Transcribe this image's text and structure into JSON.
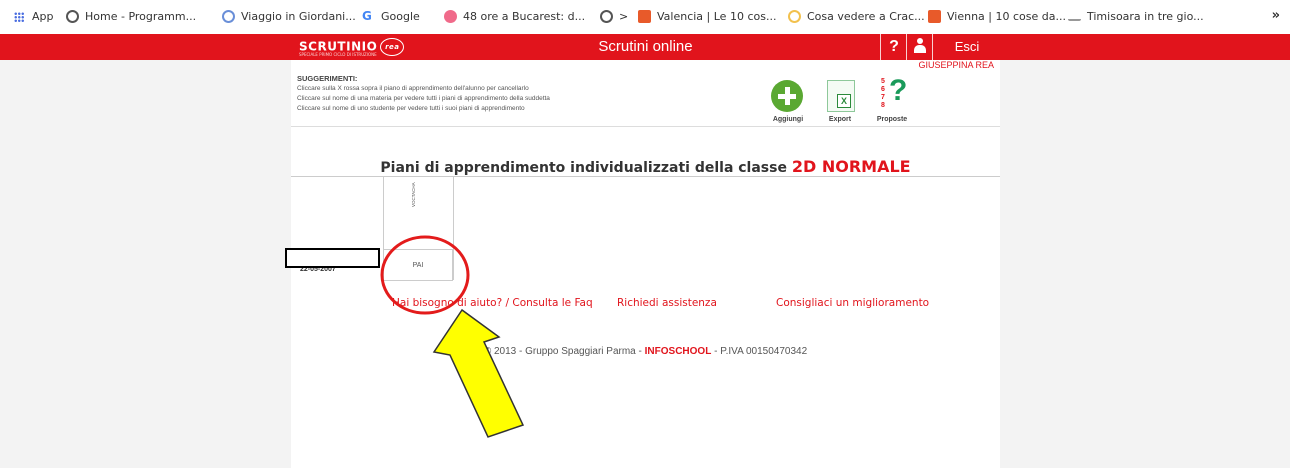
{
  "bookmarks": {
    "apps_label": "App",
    "items": [
      {
        "label": "Home - Programm..."
      },
      {
        "label": "Viaggio in Giordani..."
      },
      {
        "label": "Google"
      },
      {
        "label": "48 ore a Bucarest: d..."
      },
      {
        "label": ">"
      },
      {
        "label": "Valencia | Le 10 cos..."
      },
      {
        "label": "Cosa vedere a Crac..."
      },
      {
        "label": "Vienna | 10 cose da..."
      },
      {
        "label": "Timisoara in tre gio..."
      }
    ],
    "more": "»"
  },
  "header": {
    "logo": "SCRUTINIO",
    "logo_sub": "SPECIALE PRIMO CICLO DI ISTRUZIONE",
    "title": "Scrutini online",
    "help_label": "?",
    "exit_label": "Esci"
  },
  "user": {
    "name": "GIUSEPPINA REA"
  },
  "suggestions": {
    "heading": "SUGGERIMENTI:",
    "lines": [
      "Cliccare sulla X rossa sopra il piano di apprendimento dell'alunno per cancellarlo",
      "Cliccare sul nome di una materia per vedere tutti i piani di apprendimento della suddetta",
      "Cliccare sul nome di uno studente per vedere tutti i suoi piani di apprendimento"
    ]
  },
  "actions": {
    "add": "Aggiungi",
    "export": "Export",
    "proposals": "Proposte"
  },
  "page": {
    "heading": "Piani di apprendimento individualizzati della classe",
    "class_name": "2D NORMALE"
  },
  "table": {
    "subject": "VOCTACHA",
    "cell_label": "PAI",
    "date": "22-05-2007"
  },
  "footer": {
    "help_link": "Hai bisogno di aiuto? / Consulta le Faq",
    "assist_link": "Richiedi assistenza",
    "improve_link": "Consigliaci un miglioramento",
    "copyright_prefix": "© 2013 - Gruppo Spaggiari Parma -",
    "brand": "INFOSCHOOL",
    "copyright_suffix": "- P.IVA 00150470342"
  },
  "colors": {
    "brand_red": "#e1141c",
    "annotation_red": "#e31b1b",
    "arrow_yellow": "#ffff00"
  }
}
